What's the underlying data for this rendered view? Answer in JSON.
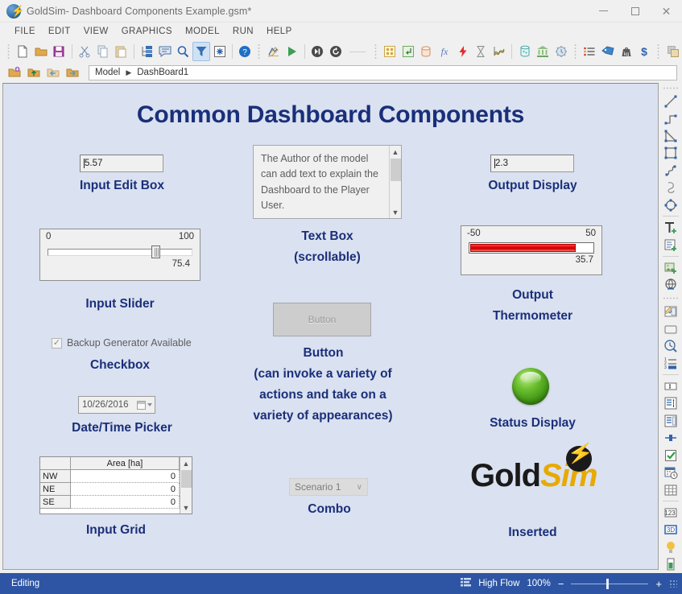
{
  "window": {
    "app_name": "GoldSim",
    "document_title": " - Dashboard Components Example.gsm*",
    "app_icon": "goldsim-bolt-icon",
    "controls": {
      "minimize": "minimize-button",
      "maximize": "maximize-button",
      "close": "close-button"
    }
  },
  "menu": {
    "items": [
      "FILE",
      "EDIT",
      "VIEW",
      "GRAPHICS",
      "MODEL",
      "RUN",
      "HELP"
    ]
  },
  "toolbar": {
    "groups": [
      {
        "icons": [
          {
            "name": "new-file-icon",
            "glyph": "page"
          },
          {
            "name": "open-folder-icon",
            "glyph": "folder"
          },
          {
            "name": "save-icon",
            "glyph": "save"
          }
        ]
      },
      {
        "icons": [
          {
            "name": "cut-icon",
            "glyph": "scissors"
          },
          {
            "name": "copy-icon",
            "glyph": "copy"
          },
          {
            "name": "paste-icon",
            "glyph": "paste"
          }
        ]
      },
      {
        "icons": [
          {
            "name": "hierarchy-icon",
            "glyph": "tree"
          },
          {
            "name": "note-icon",
            "glyph": "comment"
          },
          {
            "name": "zoom-search-icon",
            "glyph": "magnifier"
          },
          {
            "name": "filter-icon",
            "glyph": "funnel",
            "active": true
          },
          {
            "name": "settings-icon",
            "glyph": "gear-box"
          }
        ]
      },
      {
        "icons": [
          {
            "name": "help-icon",
            "glyph": "question"
          }
        ]
      },
      {
        "icons": [
          {
            "name": "edit-mode-icon",
            "glyph": "pencil-chart"
          },
          {
            "name": "run-icon",
            "glyph": "play"
          }
        ]
      },
      {
        "icons": [
          {
            "name": "step-icon",
            "glyph": "step"
          },
          {
            "name": "reset-icon",
            "glyph": "reset"
          }
        ]
      },
      {
        "icons": [
          {
            "name": "container-icon",
            "glyph": "grid-box"
          },
          {
            "name": "import-icon",
            "glyph": "import"
          },
          {
            "name": "reservoir-icon",
            "glyph": "cylinder"
          },
          {
            "name": "function-icon",
            "glyph": "fx"
          },
          {
            "name": "event-icon",
            "glyph": "bolt"
          },
          {
            "name": "delay-icon",
            "glyph": "hourglass"
          },
          {
            "name": "history-icon",
            "glyph": "wave"
          }
        ]
      },
      {
        "icons": [
          {
            "name": "pool-icon",
            "glyph": "beaker"
          },
          {
            "name": "bank-icon",
            "glyph": "bank"
          },
          {
            "name": "process-icon",
            "glyph": "gear-circle"
          }
        ]
      },
      {
        "icons": [
          {
            "name": "list-icon",
            "glyph": "list"
          },
          {
            "name": "tag-icon",
            "glyph": "tag"
          },
          {
            "name": "mass-icon",
            "glyph": "weight"
          },
          {
            "name": "currency-icon",
            "glyph": "dollar"
          }
        ]
      },
      {
        "icons": [
          {
            "name": "layers-icon",
            "glyph": "layers"
          }
        ]
      }
    ]
  },
  "breadcrumb": {
    "buttons": [
      {
        "name": "new-container-icon"
      },
      {
        "name": "go-up-icon"
      },
      {
        "name": "go-back-icon"
      },
      {
        "name": "go-forward-icon"
      }
    ],
    "path": [
      "Model",
      "DashBoard1"
    ],
    "separator": "▶"
  },
  "dashboard": {
    "title": "Common Dashboard Components",
    "background_color": "#dae1f0",
    "label_color": "#1a2f7a",
    "controls": {
      "input_edit_box": {
        "value": "5.57",
        "caption": "Input Edit Box"
      },
      "input_slider": {
        "min_label": "0",
        "max_label": "100",
        "value_label": "75.4",
        "value": 75.4,
        "caption": "Input Slider"
      },
      "checkbox": {
        "label": "Backup Generator Available",
        "checked": true,
        "check_glyph": "✓",
        "caption": "Checkbox"
      },
      "date_picker": {
        "value": "10/26/2016",
        "caption": "Date/Time Picker"
      },
      "input_grid": {
        "column_headers": [
          "",
          "Area [ha]"
        ],
        "rows": [
          {
            "header": "NW",
            "value": "0"
          },
          {
            "header": "NE",
            "value": "0"
          },
          {
            "header": "SE",
            "value": "0"
          }
        ],
        "caption": "Input Grid"
      },
      "text_box": {
        "text": "The Author of the model can add text to explain the Dashboard to the Player User.",
        "caption_line1": "Text Box",
        "caption_line2": "(scrollable)"
      },
      "button": {
        "label": "Button",
        "disabled": true,
        "caption_line1": "Button",
        "caption_line2": "(can invoke a variety of",
        "caption_line3": "actions and take on a",
        "caption_line4": "variety of appearances)"
      },
      "combo": {
        "value": "Scenario 1",
        "caret": "∨",
        "caption": "Combo"
      },
      "output_display": {
        "value": "2.3",
        "caption": "Output Display"
      },
      "output_thermometer": {
        "min_label": "-50",
        "max_label": "50",
        "value_label": "35.7",
        "value": 35.7,
        "fill_color": "#e00000",
        "caption_line1": "Output",
        "caption_line2": "Thermometer"
      },
      "status_display": {
        "state_color": "#5bb01f",
        "caption": "Status Display"
      },
      "inserted_logo": {
        "text_part1": "Gold",
        "text_part2": "Sim",
        "color1": "#1a1a1a",
        "color2": "#e8a900",
        "caption": "Inserted"
      }
    }
  },
  "tool_strip": {
    "items": [
      {
        "name": "line-tool-icon"
      },
      {
        "name": "polyline-tool-icon"
      },
      {
        "name": "polygon-tool-icon"
      },
      {
        "name": "rectangle-tool-icon"
      },
      {
        "name": "curve-tool-icon"
      },
      {
        "name": "freeform-tool-icon"
      },
      {
        "name": "ellipse-tool-icon"
      },
      {
        "sep": true
      },
      {
        "name": "add-text-icon"
      },
      {
        "name": "add-textblock-icon"
      },
      {
        "sep": true
      },
      {
        "name": "add-image-icon"
      },
      {
        "name": "add-hyperlink-icon"
      },
      {
        "sep": true
      },
      {
        "name": "dashboard-edit-icon"
      },
      {
        "name": "panel-tool-icon"
      },
      {
        "name": "clock-tool-icon"
      },
      {
        "name": "numbered-list-icon"
      },
      {
        "sep": true
      },
      {
        "name": "input-edit-box-tool-icon"
      },
      {
        "name": "input-slider-tool-icon"
      },
      {
        "name": "output-display-tool-icon"
      },
      {
        "name": "thermometer-tool-icon"
      },
      {
        "name": "checkbox-tool-icon"
      },
      {
        "name": "date-picker-tool-icon"
      },
      {
        "name": "grid-tool-icon"
      },
      {
        "sep": true
      },
      {
        "name": "spinner-tool-icon"
      },
      {
        "name": "result-display-tool-icon"
      },
      {
        "name": "status-light-tool-icon"
      },
      {
        "name": "progress-bar-tool-icon"
      }
    ]
  },
  "status_bar": {
    "mode": "Editing",
    "scenario_icon": "scenario-icon",
    "scenario": "High Flow",
    "zoom_level": "100%",
    "zoom_out": "−",
    "zoom_in": "+",
    "background_color": "#2d55a4"
  }
}
